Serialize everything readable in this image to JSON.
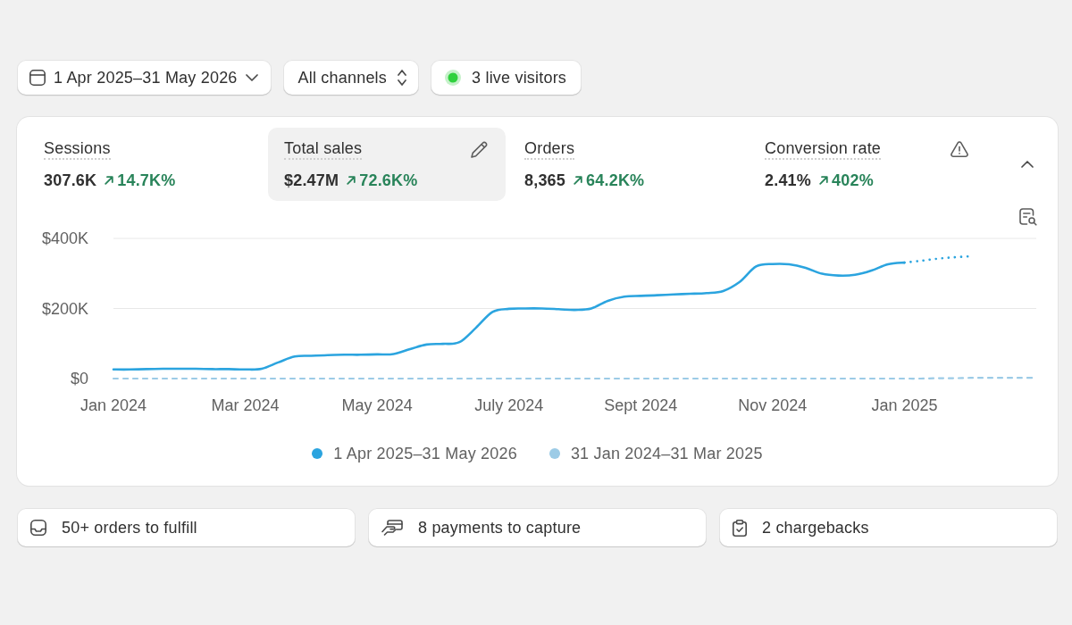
{
  "filters": [
    {
      "kind": "date",
      "label": "1 Apr 2025–31 May 2026"
    },
    {
      "kind": "select",
      "label": "All channels"
    },
    {
      "kind": "live",
      "label": "3 live visitors"
    }
  ],
  "overview": {
    "expanded": true,
    "metrics": [
      {
        "label": "Sessions",
        "value": "307.6K",
        "change": "14.7K%",
        "increase": true,
        "selected": false,
        "warning": false
      },
      {
        "label": "Total sales",
        "value": "$2.47M",
        "change": "72.6K%",
        "increase": true,
        "selected": true,
        "warning": false
      },
      {
        "label": "Orders",
        "value": "8,365",
        "change": "64.2K%",
        "increase": true,
        "selected": false,
        "warning": false
      },
      {
        "label": "Conversion rate",
        "value": "2.41%",
        "change": "402%",
        "increase": true,
        "selected": false,
        "warning": true
      }
    ],
    "chart_data": {
      "type": "line",
      "categories": [
        "Jan 2024",
        null,
        null,
        null,
        null,
        null,
        null,
        null,
        "Mar 2024",
        null,
        null,
        null,
        null,
        null,
        null,
        null,
        "May 2024",
        null,
        null,
        null,
        null,
        null,
        null,
        null,
        "July 2024",
        null,
        null,
        null,
        null,
        null,
        null,
        null,
        "Sept 2024",
        null,
        null,
        null,
        null,
        null,
        null,
        null,
        "Nov 2024",
        null,
        null,
        null,
        null,
        null,
        null,
        null,
        "Jan 2025",
        null,
        null,
        null,
        null,
        null,
        null,
        null,
        null
      ],
      "ylim": [
        0,
        400
      ],
      "yticks": [
        {
          "value": 0,
          "label": "$0"
        },
        {
          "value": 200,
          "label": "$200K"
        },
        {
          "value": 400,
          "label": "$400K"
        }
      ],
      "series": [
        {
          "name": "1 Apr 2025–31 May 2026",
          "color": "#2ba4df",
          "line_style": "solid",
          "values": [
            26,
            26,
            27,
            28,
            28,
            28,
            27,
            27,
            26,
            28,
            46,
            63,
            65,
            67,
            68,
            68,
            69,
            70,
            84,
            97,
            99,
            104,
            145,
            190,
            199,
            200,
            200,
            198,
            196,
            200,
            222,
            234,
            236,
            238,
            240,
            242,
            244,
            250,
            276,
            320,
            327,
            326,
            316,
            299,
            294,
            296,
            308,
            326,
            331,
            null,
            null,
            null,
            null,
            null,
            null,
            null,
            null
          ]
        },
        {
          "name": "31 Jan 2024–31 Mar 2025",
          "color": "#9ccbe6",
          "line_style": "dashed",
          "values": [
            0,
            0,
            0,
            0,
            0,
            0,
            0,
            0,
            0,
            0,
            0,
            0,
            0,
            0,
            0,
            0,
            0,
            0,
            0,
            0,
            0,
            0,
            0,
            0,
            0,
            0,
            0,
            0,
            0,
            0,
            0,
            0,
            0,
            0,
            0,
            0,
            0,
            0,
            0,
            0,
            0,
            0,
            0,
            0,
            0,
            0,
            0,
            0,
            0,
            0,
            1,
            1,
            2,
            2,
            2,
            2,
            2
          ]
        },
        {
          "color": "#2ba4df",
          "line_style": "dotted",
          "values": [
            null,
            null,
            null,
            null,
            null,
            null,
            null,
            null,
            null,
            null,
            null,
            null,
            null,
            null,
            null,
            null,
            null,
            null,
            null,
            null,
            null,
            null,
            null,
            null,
            null,
            null,
            null,
            null,
            null,
            null,
            null,
            null,
            null,
            null,
            null,
            null,
            null,
            null,
            null,
            null,
            null,
            null,
            null,
            null,
            null,
            null,
            null,
            null,
            331,
            336,
            342,
            346,
            349,
            null,
            null,
            null,
            null
          ]
        }
      ]
    }
  },
  "tasks": [
    {
      "kind": "fulfill",
      "label": "50+ orders to fulfill"
    },
    {
      "kind": "payments",
      "label": "8 payments to capture"
    },
    {
      "kind": "chargebacks",
      "label": "2 chargebacks"
    }
  ]
}
